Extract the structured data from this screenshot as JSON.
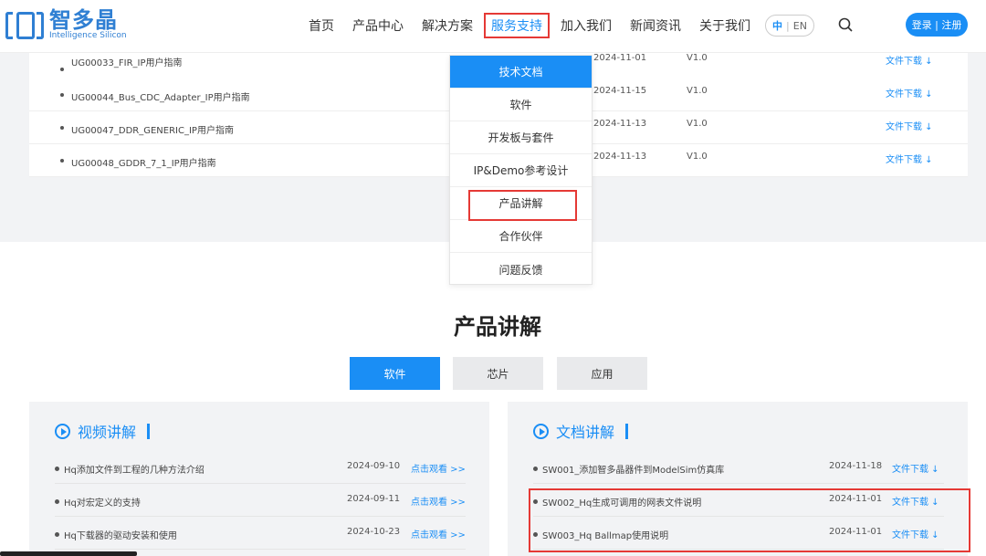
{
  "logo": {
    "cn": "智多晶",
    "en": "Intelligence Silicon"
  },
  "nav": [
    "首页",
    "产品中心",
    "解决方案",
    "服务支持",
    "加入我们",
    "新闻资讯",
    "关于我们"
  ],
  "lang": {
    "zh": "中",
    "sep": "|",
    "en": "EN"
  },
  "login": "登录 | 注册",
  "file_rows": [
    {
      "name": "UG00033_FIR_IP用户指南",
      "date": "2024-11-01",
      "ver": "V1.0",
      "dl": "文件下载 ↓"
    },
    {
      "name": "UG00044_Bus_CDC_Adapter_IP用户指南",
      "date": "2024-11-15",
      "ver": "V1.0",
      "dl": "文件下载 ↓"
    },
    {
      "name": "UG00047_DDR_GENERIC_IP用户指南",
      "date": "2024-11-13",
      "ver": "V1.0",
      "dl": "文件下载 ↓"
    },
    {
      "name": "UG00048_GDDR_7_1_IP用户指南",
      "date": "2024-11-13",
      "ver": "V1.0",
      "dl": "文件下载 ↓"
    }
  ],
  "dropdown": [
    "技术文档",
    "软件",
    "开发板与套件",
    "IP&Demo参考设计",
    "产品讲解",
    "合作伙伴",
    "问题反馈"
  ],
  "section_title": "产品讲解",
  "tabs": [
    "软件",
    "芯片",
    "应用"
  ],
  "video_panel": {
    "title": "视频讲解",
    "rows": [
      {
        "name": "Hq添加文件到工程的几种方法介绍",
        "date": "2024-09-10",
        "action": "点击观看 >>"
      },
      {
        "name": "Hq对宏定义的支持",
        "date": "2024-09-11",
        "action": "点击观看 >>"
      },
      {
        "name": "Hq下载器的驱动安装和使用",
        "date": "2024-10-23",
        "action": "点击观看 >>"
      }
    ]
  },
  "doc_panel": {
    "title": "文档讲解",
    "rows": [
      {
        "name": "SW001_添加智多晶器件到ModelSim仿真库",
        "date": "2024-11-18",
        "action": "文件下载 ↓"
      },
      {
        "name": "SW002_Hq生成可调用的网表文件说明",
        "date": "2024-11-01",
        "action": "文件下载 ↓"
      },
      {
        "name": "SW003_Hq Ballmap使用说明",
        "date": "2024-11-01",
        "action": "文件下载 ↓"
      }
    ]
  },
  "colors": {
    "accent": "#1a8ef5",
    "highlight": "#e53935",
    "panel_bg": "#f2f3f5"
  }
}
